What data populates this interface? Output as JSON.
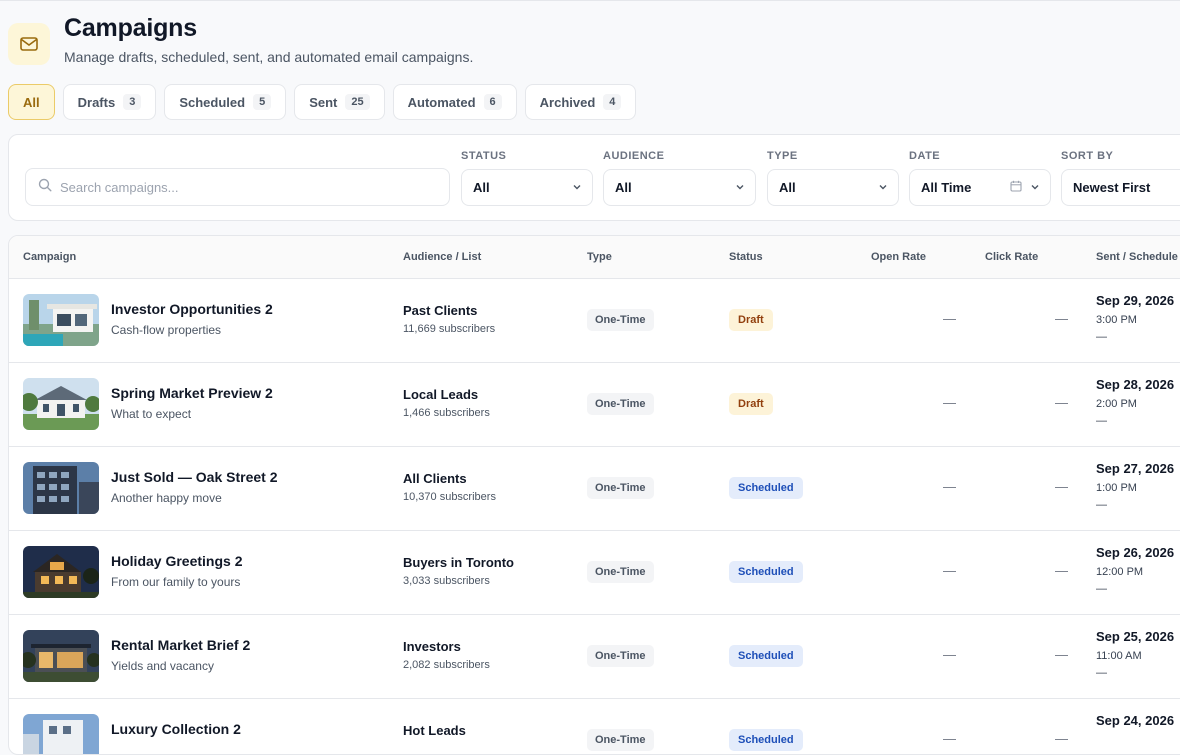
{
  "header": {
    "title": "Campaigns",
    "subtitle": "Manage drafts, scheduled, sent, and automated email campaigns.",
    "icon": "mail-icon"
  },
  "tabs": [
    {
      "label": "All",
      "count": null,
      "active": true
    },
    {
      "label": "Drafts",
      "count": "3",
      "active": false
    },
    {
      "label": "Scheduled",
      "count": "5",
      "active": false
    },
    {
      "label": "Sent",
      "count": "25",
      "active": false
    },
    {
      "label": "Automated",
      "count": "6",
      "active": false
    },
    {
      "label": "Archived",
      "count": "4",
      "active": false
    }
  ],
  "filters": {
    "search_placeholder": "Search campaigns...",
    "status": {
      "label": "STATUS",
      "value": "All"
    },
    "audience": {
      "label": "AUDIENCE",
      "value": "All"
    },
    "type": {
      "label": "TYPE",
      "value": "All"
    },
    "date": {
      "label": "DATE",
      "value": "All Time"
    },
    "sort": {
      "label": "SORT BY",
      "value": "Newest First"
    }
  },
  "table": {
    "columns": [
      "Campaign",
      "Audience / List",
      "Type",
      "Status",
      "Open Rate",
      "Click Rate",
      "Sent / Schedule"
    ],
    "rows": [
      {
        "name": "Investor Opportunities 2",
        "subtitle": "Cash-flow properties",
        "audience": "Past Clients",
        "subscribers": "11,669 subscribers",
        "type": "One-Time",
        "status": "Draft",
        "status_kind": "draft",
        "open_rate": "—",
        "click_rate": "—",
        "date": "Sep 29, 2026",
        "time": "3:00 PM",
        "extra": "—"
      },
      {
        "name": "Spring Market Preview 2",
        "subtitle": "What to expect",
        "audience": "Local Leads",
        "subscribers": "1,466 subscribers",
        "type": "One-Time",
        "status": "Draft",
        "status_kind": "draft",
        "open_rate": "—",
        "click_rate": "—",
        "date": "Sep 28, 2026",
        "time": "2:00 PM",
        "extra": "—"
      },
      {
        "name": "Just Sold — Oak Street 2",
        "subtitle": "Another happy move",
        "audience": "All Clients",
        "subscribers": "10,370 subscribers",
        "type": "One-Time",
        "status": "Scheduled",
        "status_kind": "scheduled",
        "open_rate": "—",
        "click_rate": "—",
        "date": "Sep 27, 2026",
        "time": "1:00 PM",
        "extra": "—"
      },
      {
        "name": "Holiday Greetings 2",
        "subtitle": "From our family to yours",
        "audience": "Buyers in Toronto",
        "subscribers": "3,033 subscribers",
        "type": "One-Time",
        "status": "Scheduled",
        "status_kind": "scheduled",
        "open_rate": "—",
        "click_rate": "—",
        "date": "Sep 26, 2026",
        "time": "12:00 PM",
        "extra": "—"
      },
      {
        "name": "Rental Market Brief 2",
        "subtitle": "Yields and vacancy",
        "audience": "Investors",
        "subscribers": "2,082 subscribers",
        "type": "One-Time",
        "status": "Scheduled",
        "status_kind": "scheduled",
        "open_rate": "—",
        "click_rate": "—",
        "date": "Sep 25, 2026",
        "time": "11:00 AM",
        "extra": "—"
      },
      {
        "name": "Luxury Collection 2",
        "subtitle": "",
        "audience": "Hot Leads",
        "subscribers": "",
        "type": "One-Time",
        "status": "Scheduled",
        "status_kind": "scheduled",
        "open_rate": "—",
        "click_rate": "—",
        "date": "Sep 24, 2026",
        "time": "",
        "extra": ""
      }
    ]
  },
  "colors": {
    "accent_bg": "#fdf6d8",
    "accent_border": "#ebcb68",
    "accent_text": "#9a6b0e",
    "draft_bg": "#fdf3d8",
    "scheduled_bg": "#e4ecfb"
  }
}
